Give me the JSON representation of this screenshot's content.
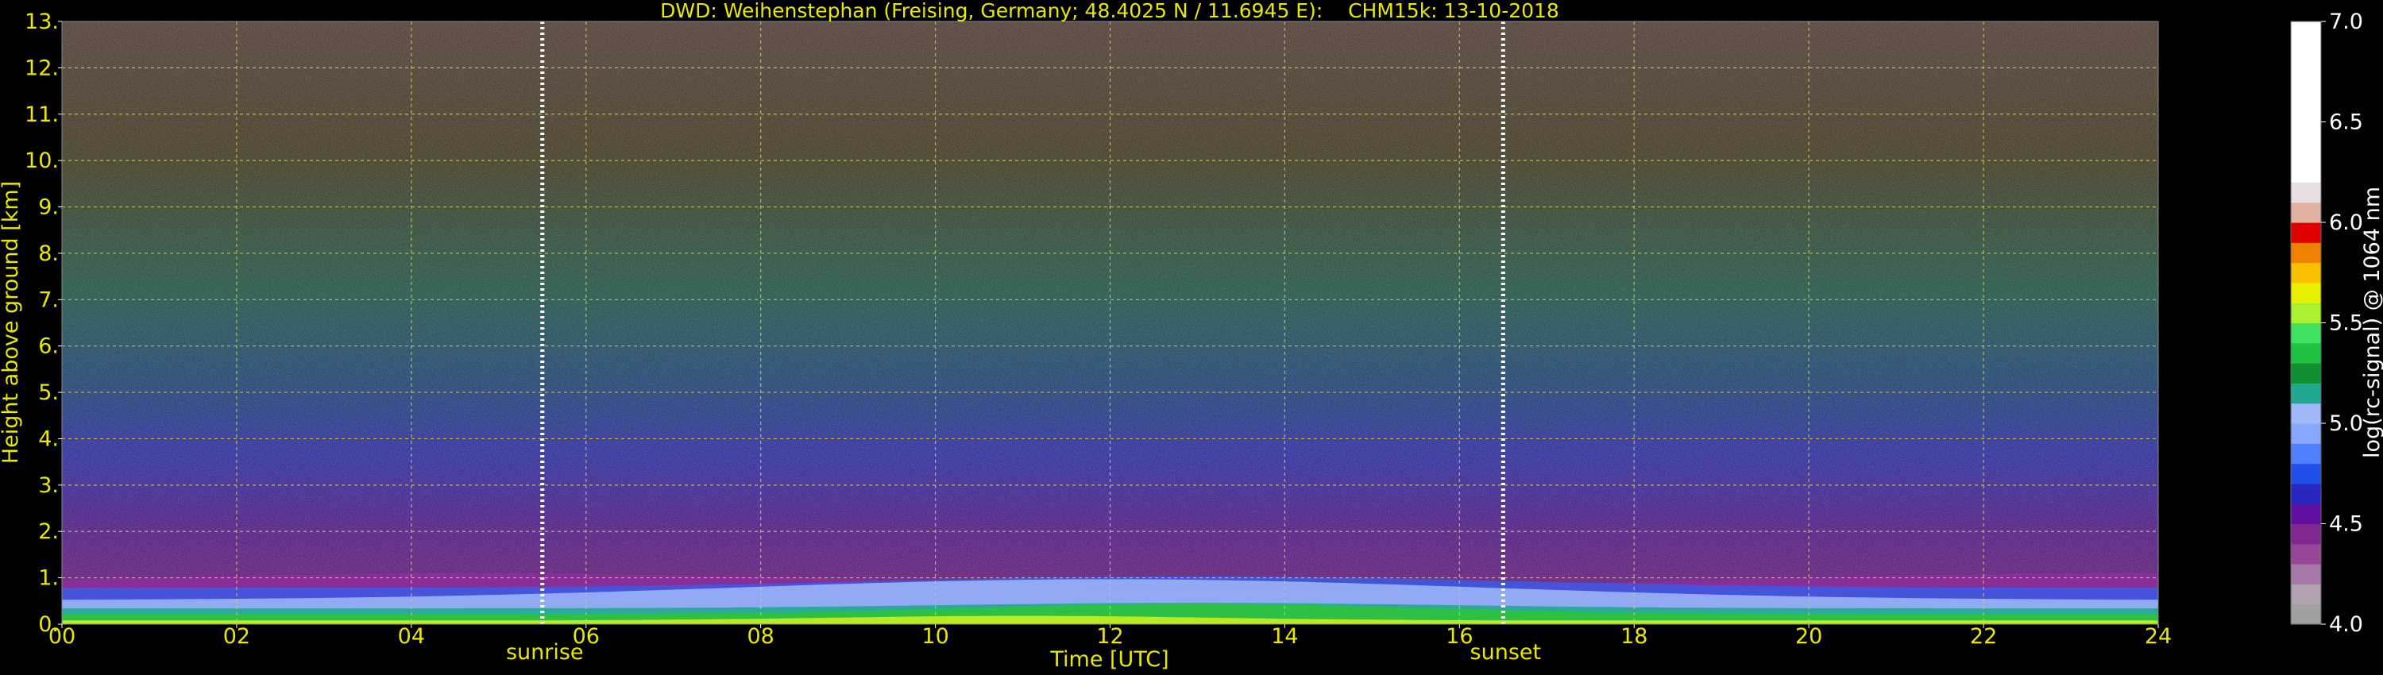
{
  "chart_data": {
    "type": "heatmap",
    "title": "DWD: Weihenstephan (Freising, Germany; 48.4025 N / 11.6945 E):    CHM15k: 13-10-2018",
    "xlabel": "Time [UTC]",
    "ylabel": "Height above ground [km]",
    "xlim": [
      0,
      24
    ],
    "ylim": [
      0,
      13
    ],
    "x_ticks": [
      "00",
      "02",
      "04",
      "06",
      "08",
      "10",
      "12",
      "14",
      "16",
      "18",
      "20",
      "22",
      "24"
    ],
    "y_ticks": [
      "0.",
      "1.",
      "2.",
      "3.",
      "4.",
      "5.",
      "6.",
      "7.",
      "8.",
      "9.",
      "10.",
      "11.",
      "12.",
      "13."
    ],
    "grid": true,
    "annotations": [
      {
        "label": "sunrise",
        "x": 5.5
      },
      {
        "label": "sunset",
        "x": 16.5
      }
    ],
    "colorbar": {
      "label": "log(rc-signal) @ 1064 nm",
      "range": [
        4.0,
        7.0
      ],
      "ticks": [
        "4.0",
        "4.5",
        "5.0",
        "5.5",
        "6.0",
        "6.5",
        "7.0"
      ],
      "colors": [
        {
          "from": 4.0,
          "to": 4.1,
          "color": "#a0a0a0"
        },
        {
          "from": 4.1,
          "to": 4.2,
          "color": "#b0a0b0"
        },
        {
          "from": 4.2,
          "to": 4.3,
          "color": "#a878a8"
        },
        {
          "from": 4.3,
          "to": 4.4,
          "color": "#984898"
        },
        {
          "from": 4.4,
          "to": 4.5,
          "color": "#802890"
        },
        {
          "from": 4.5,
          "to": 4.6,
          "color": "#6010a0"
        },
        {
          "from": 4.6,
          "to": 4.7,
          "color": "#2828c0"
        },
        {
          "from": 4.7,
          "to": 4.8,
          "color": "#2050e8"
        },
        {
          "from": 4.8,
          "to": 4.9,
          "color": "#5080ff"
        },
        {
          "from": 4.9,
          "to": 5.0,
          "color": "#88a8ff"
        },
        {
          "from": 5.0,
          "to": 5.1,
          "color": "#a0b8f8"
        },
        {
          "from": 5.1,
          "to": 5.2,
          "color": "#20a890"
        },
        {
          "from": 5.2,
          "to": 5.3,
          "color": "#109030"
        },
        {
          "from": 5.3,
          "to": 5.4,
          "color": "#20c040"
        },
        {
          "from": 5.4,
          "to": 5.5,
          "color": "#40e060"
        },
        {
          "from": 5.5,
          "to": 5.6,
          "color": "#a8f030"
        },
        {
          "from": 5.6,
          "to": 5.7,
          "color": "#e8f000"
        },
        {
          "from": 5.7,
          "to": 5.8,
          "color": "#f8c000"
        },
        {
          "from": 5.8,
          "to": 5.9,
          "color": "#f08000"
        },
        {
          "from": 5.9,
          "to": 6.0,
          "color": "#e00000"
        },
        {
          "from": 6.0,
          "to": 6.1,
          "color": "#e0b0a0"
        },
        {
          "from": 6.1,
          "to": 6.2,
          "color": "#e8e0e0"
        },
        {
          "from": 6.2,
          "to": 7.0,
          "color": "#ffffff"
        }
      ]
    }
  }
}
